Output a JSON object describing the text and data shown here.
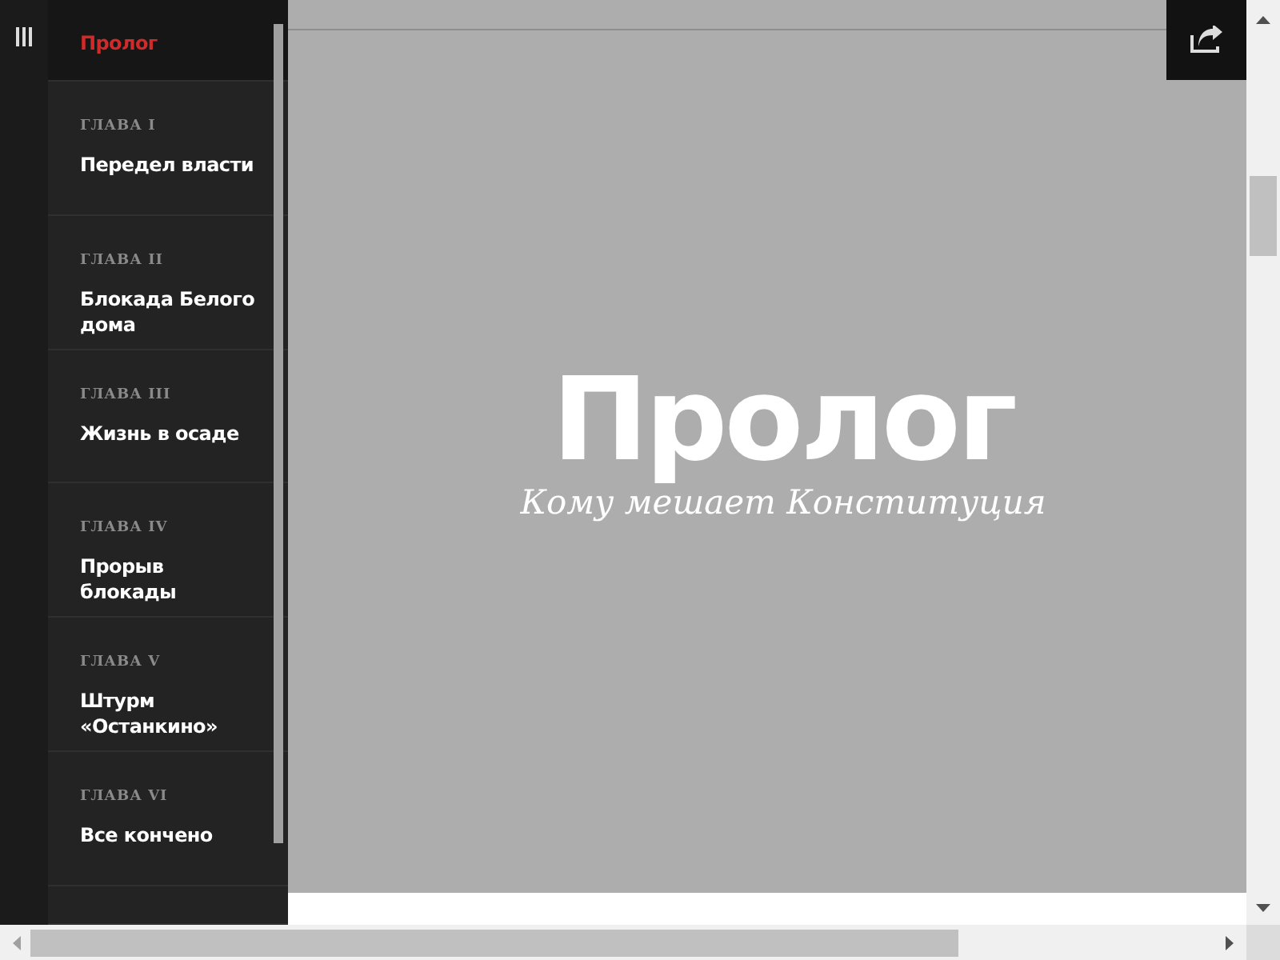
{
  "sidebar": {
    "items": [
      {
        "title": "Пролог",
        "selected": true
      },
      {
        "label": "ГЛАВА I",
        "title": "Передел власти",
        "selected": false
      },
      {
        "label": "ГЛАВА II",
        "title": "Блокада Белого дома",
        "selected": false
      },
      {
        "label": "ГЛАВА III",
        "title": "Жизнь в осаде",
        "selected": false
      },
      {
        "label": "ГЛАВА IV",
        "title": "Прорыв блокады",
        "selected": false
      },
      {
        "label": "ГЛАВА V",
        "title": "Штурм «Останкино»",
        "selected": false
      },
      {
        "label": "ГЛАВА VI",
        "title": "Все кончено",
        "selected": false
      }
    ]
  },
  "hero": {
    "title": "Пролог",
    "subtitle": "Кому мешает Конституция"
  }
}
